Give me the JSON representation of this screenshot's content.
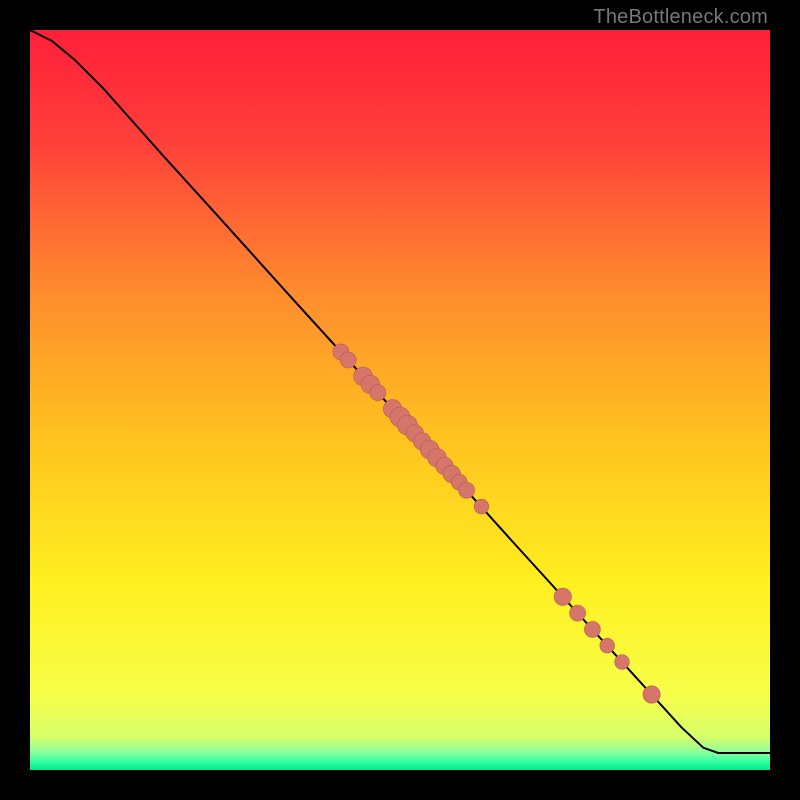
{
  "watermark": "TheBottleneck.com",
  "colors": {
    "gradient_stops": [
      {
        "offset": 0.0,
        "color": "#ff1f3a"
      },
      {
        "offset": 0.15,
        "color": "#ff3f3a"
      },
      {
        "offset": 0.35,
        "color": "#ff8a2e"
      },
      {
        "offset": 0.55,
        "color": "#ffc21f"
      },
      {
        "offset": 0.75,
        "color": "#fff020"
      },
      {
        "offset": 0.9,
        "color": "#f7ff4a"
      },
      {
        "offset": 0.955,
        "color": "#d7ff6a"
      },
      {
        "offset": 0.975,
        "color": "#8fff9a"
      },
      {
        "offset": 0.99,
        "color": "#2effa5"
      },
      {
        "offset": 1.0,
        "color": "#00e887"
      }
    ],
    "line": "#000000",
    "dot_fill": "#d6756a",
    "dot_stroke": "#b55a52"
  },
  "chart_data": {
    "type": "line",
    "title": "",
    "xlabel": "",
    "ylabel": "",
    "xlim": [
      0,
      100
    ],
    "ylim": [
      0,
      100
    ],
    "series": [
      {
        "name": "curve",
        "x": [
          0,
          3,
          6,
          10,
          14,
          18,
          25,
          35,
          45,
          55,
          65,
          75,
          82,
          88,
          91,
          93,
          100
        ],
        "y": [
          100,
          98.5,
          96,
          92,
          87.5,
          83,
          75.3,
          64.2,
          53.2,
          42.2,
          31.1,
          20.1,
          12.4,
          5.8,
          3.0,
          2.3,
          2.3
        ]
      }
    ],
    "dots": {
      "name": "markers",
      "points": [
        {
          "x": 42,
          "y": 56.5,
          "r": 1.2
        },
        {
          "x": 43,
          "y": 55.4,
          "r": 1.2
        },
        {
          "x": 45,
          "y": 53.2,
          "r": 1.4
        },
        {
          "x": 46,
          "y": 52.1,
          "r": 1.4
        },
        {
          "x": 47,
          "y": 51.0,
          "r": 1.2
        },
        {
          "x": 49,
          "y": 48.8,
          "r": 1.4
        },
        {
          "x": 50,
          "y": 47.7,
          "r": 1.5
        },
        {
          "x": 51,
          "y": 46.6,
          "r": 1.5
        },
        {
          "x": 52,
          "y": 45.5,
          "r": 1.3
        },
        {
          "x": 53,
          "y": 44.4,
          "r": 1.3
        },
        {
          "x": 54,
          "y": 43.3,
          "r": 1.4
        },
        {
          "x": 55,
          "y": 42.2,
          "r": 1.4
        },
        {
          "x": 56,
          "y": 41.1,
          "r": 1.3
        },
        {
          "x": 57,
          "y": 40.0,
          "r": 1.3
        },
        {
          "x": 58,
          "y": 38.9,
          "r": 1.2
        },
        {
          "x": 59,
          "y": 37.8,
          "r": 1.2
        },
        {
          "x": 61,
          "y": 35.6,
          "r": 1.1
        },
        {
          "x": 72,
          "y": 23.4,
          "r": 1.3
        },
        {
          "x": 74,
          "y": 21.2,
          "r": 1.2
        },
        {
          "x": 76,
          "y": 19.0,
          "r": 1.2
        },
        {
          "x": 78,
          "y": 16.8,
          "r": 1.1
        },
        {
          "x": 80,
          "y": 14.6,
          "r": 1.1
        },
        {
          "x": 84,
          "y": 10.2,
          "r": 1.3
        }
      ]
    }
  }
}
